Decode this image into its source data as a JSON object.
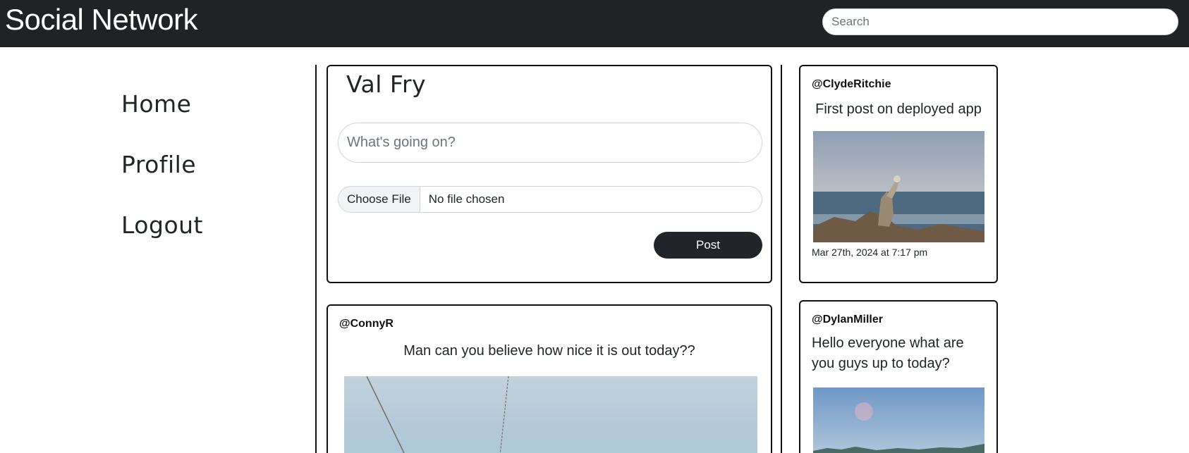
{
  "header": {
    "brand": "Social Network",
    "search_placeholder": "Search"
  },
  "sidebar": {
    "items": [
      {
        "label": "Home"
      },
      {
        "label": "Profile"
      },
      {
        "label": "Logout"
      }
    ]
  },
  "composer": {
    "user_name": "Val Fry",
    "input_placeholder": "What's going on?",
    "file_button_label": "Choose File",
    "file_status": "No file chosen",
    "post_label": "Post"
  },
  "feed": {
    "posts": [
      {
        "handle": "@ConnyR",
        "text": "Man can you believe how nice it is out today??"
      }
    ]
  },
  "right_column": {
    "posts": [
      {
        "handle": "@ClydeRitchie",
        "text": "First post on deployed app",
        "timestamp": "Mar 27th, 2024 at 7:17 pm"
      },
      {
        "handle": "@DylanMiller",
        "text": "Hello everyone what are you guys up to today?"
      }
    ]
  }
}
